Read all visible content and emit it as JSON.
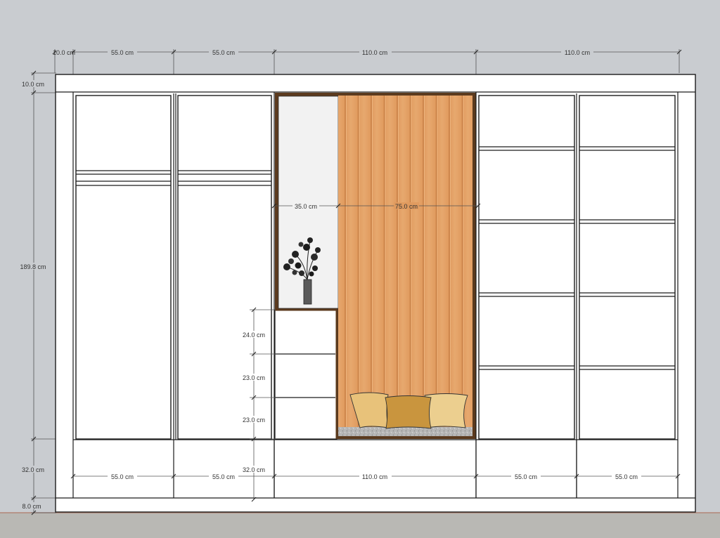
{
  "drawing": {
    "top_dimensions": [
      "10.0 cm",
      "55.0 cm",
      "55.0 cm",
      "110.0 cm",
      "110.0 cm"
    ],
    "left_dimensions": [
      "10.0 cm",
      "189.8 cm",
      "32.0 cm",
      "8.0 cm"
    ],
    "inner_dimensions": {
      "niche_width": "35.0 cm",
      "panel_width": "75.0 cm",
      "drawer_heights": [
        "24.0 cm",
        "23.0 cm",
        "23.0 cm"
      ],
      "base_height": "32.0 cm"
    },
    "bottom_dimensions": [
      "55.0 cm",
      "55.0 cm",
      "110.0 cm",
      "55.0 cm",
      "55.0 cm"
    ]
  },
  "colors": {
    "background": "#c9ccd0",
    "floor": "#b9b8b4",
    "floor_line": "#b07a68",
    "wood_panel": "#e3a066",
    "wood_frame": "#5b3a1e",
    "niche_back": "#f2f2f2",
    "cushion": "#e8c27a",
    "cushion_dark": "#c9953e"
  },
  "icons": [
    "plant-vase-icon",
    "cushion-icon"
  ]
}
